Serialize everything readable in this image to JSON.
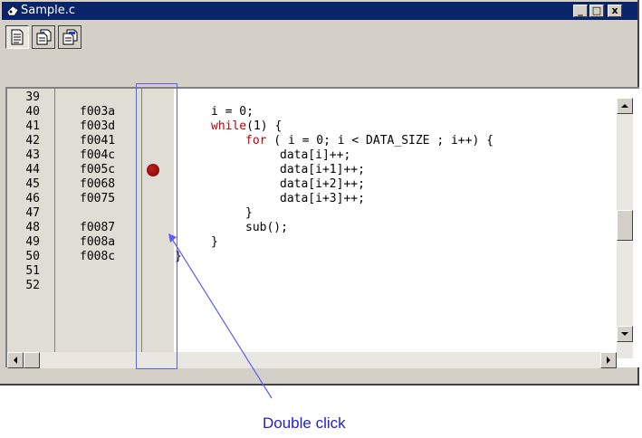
{
  "window": {
    "title": "Sample.c",
    "controls": {
      "minimize": "_",
      "maximize": "□",
      "close": "x"
    }
  },
  "toolbar": {
    "buttons": [
      {
        "icon": "source-view-icon",
        "pressed": true
      },
      {
        "icon": "disassembly-view-icon",
        "pressed": false
      },
      {
        "icon": "mixed-view-icon",
        "pressed": false
      }
    ]
  },
  "editor": {
    "rows": [
      {
        "line": "39",
        "address": "",
        "code": "",
        "keyword": "",
        "breakpoint": false
      },
      {
        "line": "40",
        "address": "f003a",
        "code": "i = 0;",
        "keyword": "",
        "breakpoint": false
      },
      {
        "line": "41",
        "address": "f003d",
        "code": "(1) {",
        "keyword": "while",
        "breakpoint": false
      },
      {
        "line": "42",
        "address": "f0041",
        "code": " ( i = 0; i < DATA_SIZE ; i++) {",
        "keyword": "for",
        "breakpoint": false
      },
      {
        "line": "43",
        "address": "f004c",
        "code": "data[i]++;",
        "keyword": "",
        "breakpoint": false
      },
      {
        "line": "44",
        "address": "f005c",
        "code": "data[i+1]++;",
        "keyword": "",
        "breakpoint": true
      },
      {
        "line": "45",
        "address": "f0068",
        "code": "data[i+2]++;",
        "keyword": "",
        "breakpoint": false
      },
      {
        "line": "46",
        "address": "f0075",
        "code": "data[i+3]++;",
        "keyword": "",
        "breakpoint": false
      },
      {
        "line": "47",
        "address": "",
        "code": "}",
        "keyword": "",
        "breakpoint": false
      },
      {
        "line": "48",
        "address": "f0087",
        "code": "sub();",
        "keyword": "",
        "breakpoint": false
      },
      {
        "line": "49",
        "address": "f008a",
        "code": "}",
        "keyword": "",
        "breakpoint": false
      },
      {
        "line": "50",
        "address": "f008c",
        "code": "}",
        "keyword": "",
        "breakpoint": false
      },
      {
        "line": "51",
        "address": "",
        "code": "",
        "keyword": "",
        "breakpoint": false
      },
      {
        "line": "52",
        "address": "",
        "code": "",
        "keyword": "",
        "breakpoint": false
      }
    ]
  },
  "annotation": {
    "text": "Double click",
    "color": "#2020d0"
  },
  "colors": {
    "titlebar": "#0a246a",
    "keyword": "#c00000",
    "breakpoint": "#a01010",
    "annotation": "#5c5cff"
  }
}
